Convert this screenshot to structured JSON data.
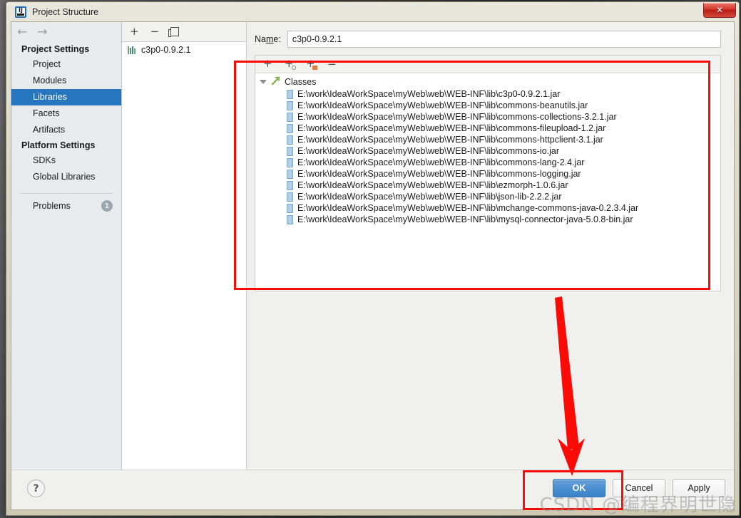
{
  "window": {
    "title": "Project Structure",
    "app_icon": "intellij-idea-icon",
    "close_label": "✕"
  },
  "sidebar": {
    "nav": {
      "back": "←",
      "forward": "→"
    },
    "groups": [
      {
        "title": "Project Settings",
        "items": [
          {
            "label": "Project",
            "selected": false
          },
          {
            "label": "Modules",
            "selected": false
          },
          {
            "label": "Libraries",
            "selected": true
          },
          {
            "label": "Facets",
            "selected": false
          },
          {
            "label": "Artifacts",
            "selected": false
          }
        ]
      },
      {
        "title": "Platform Settings",
        "items": [
          {
            "label": "SDKs",
            "selected": false
          },
          {
            "label": "Global Libraries",
            "selected": false
          }
        ]
      }
    ],
    "problems": {
      "label": "Problems",
      "count": "1"
    }
  },
  "library_column": {
    "toolbar": [
      {
        "name": "add-library-button",
        "glyph": "+"
      },
      {
        "name": "remove-library-button",
        "glyph": "−"
      },
      {
        "name": "copy-library-button",
        "glyph": "copy-icon"
      }
    ],
    "items": [
      {
        "label": "c3p0-0.9.2.1",
        "icon": "library-bars-icon"
      }
    ]
  },
  "detail": {
    "name_label_prefix": "Na",
    "name_label_mnemonic": "m",
    "name_label_suffix": "e:",
    "name_value": "c3p0-0.9.2.1",
    "name_placeholder": "",
    "roots_toolbar": [
      {
        "name": "add-root-button",
        "glyph": "+"
      },
      {
        "name": "add-source-root-button",
        "glyph": "+"
      },
      {
        "name": "add-jar-directory-button",
        "glyph": "+"
      },
      {
        "name": "remove-root-button",
        "glyph": "−"
      }
    ],
    "tree": {
      "root_label": "Classes",
      "root_icon": "classes-folder-icon",
      "files": [
        "E:\\work\\IdeaWorkSpace\\myWeb\\web\\WEB-INF\\lib\\c3p0-0.9.2.1.jar",
        "E:\\work\\IdeaWorkSpace\\myWeb\\web\\WEB-INF\\lib\\commons-beanutils.jar",
        "E:\\work\\IdeaWorkSpace\\myWeb\\web\\WEB-INF\\lib\\commons-collections-3.2.1.jar",
        "E:\\work\\IdeaWorkSpace\\myWeb\\web\\WEB-INF\\lib\\commons-fileupload-1.2.jar",
        "E:\\work\\IdeaWorkSpace\\myWeb\\web\\WEB-INF\\lib\\commons-httpclient-3.1.jar",
        "E:\\work\\IdeaWorkSpace\\myWeb\\web\\WEB-INF\\lib\\commons-io.jar",
        "E:\\work\\IdeaWorkSpace\\myWeb\\web\\WEB-INF\\lib\\commons-lang-2.4.jar",
        "E:\\work\\IdeaWorkSpace\\myWeb\\web\\WEB-INF\\lib\\commons-logging.jar",
        "E:\\work\\IdeaWorkSpace\\myWeb\\web\\WEB-INF\\lib\\ezmorph-1.0.6.jar",
        "E:\\work\\IdeaWorkSpace\\myWeb\\web\\WEB-INF\\lib\\json-lib-2.2.2.jar",
        "E:\\work\\IdeaWorkSpace\\myWeb\\web\\WEB-INF\\lib\\mchange-commons-java-0.2.3.4.jar",
        "E:\\work\\IdeaWorkSpace\\myWeb\\web\\WEB-INF\\lib\\mysql-connector-java-5.0.8-bin.jar"
      ]
    }
  },
  "footer": {
    "help_glyph": "?",
    "buttons": [
      {
        "label": "OK",
        "primary": true
      },
      {
        "label": "Cancel",
        "primary": false
      },
      {
        "label": "Apply",
        "primary": false
      }
    ]
  },
  "annotations": {
    "color": "#fb0b06",
    "rect_roots_name": "highlight-roots-panel",
    "rect_ok_name": "highlight-ok-button",
    "arrow_name": "pointer-arrow-to-ok"
  },
  "watermark": {
    "text": "CSDN @编程界明世隐"
  }
}
